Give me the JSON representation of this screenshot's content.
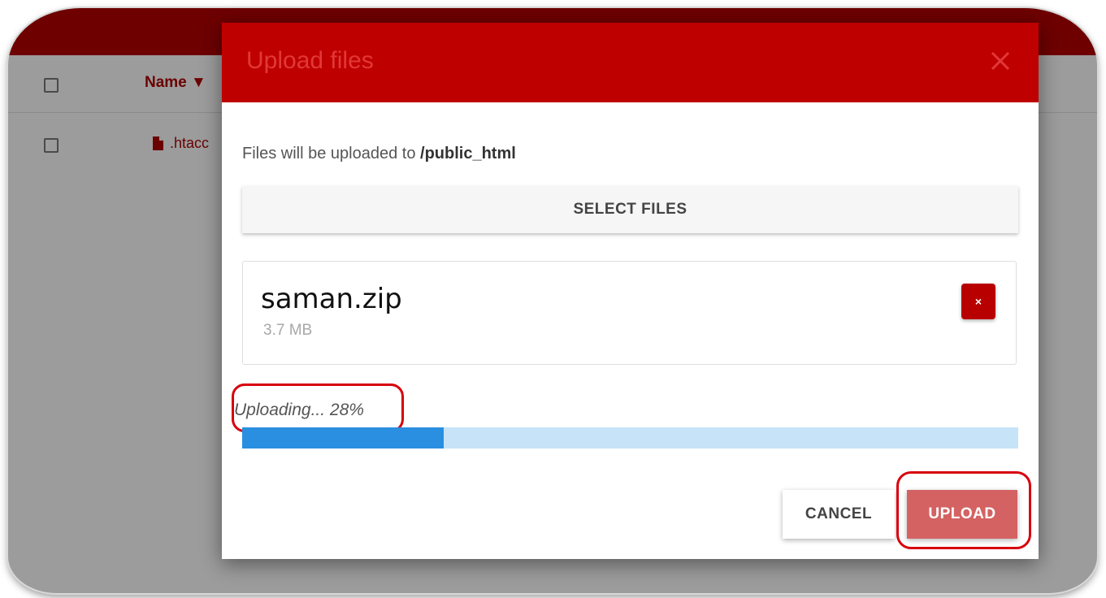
{
  "background": {
    "table": {
      "name_header": "Name ▼",
      "rows": [
        {
          "name": ".htacc"
        }
      ]
    }
  },
  "dialog": {
    "title": "Upload files",
    "destination_prefix": "Files will be uploaded to ",
    "destination_path": "/public_html",
    "select_files_label": "SELECT FILES",
    "file": {
      "name": "saman.zip",
      "size": "3.7 MB",
      "remove_label": "×"
    },
    "status_text": "Uploading... 28%",
    "progress_percent": 26,
    "cancel_label": "CANCEL",
    "upload_label": "UPLOAD"
  },
  "colors": {
    "header_red": "#bf0000",
    "progress_fill": "#2a8fe0",
    "progress_track": "#c7e3f8",
    "annotation_outline": "#d8000c"
  }
}
